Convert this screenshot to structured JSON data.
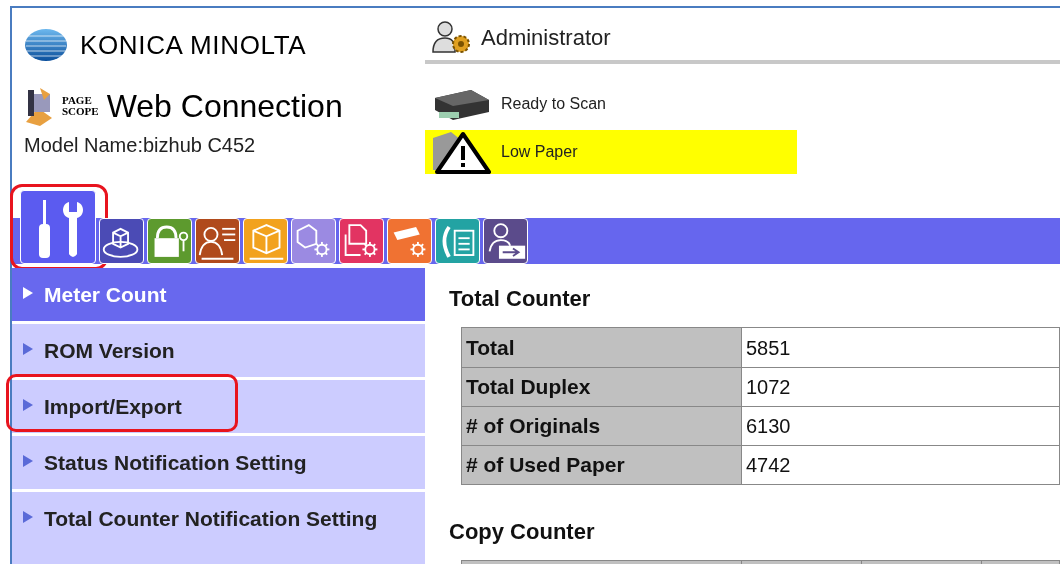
{
  "header": {
    "brand": "KONICA MINOLTA",
    "product_small_top": "PAGE",
    "product_small_bottom": "SCOPE",
    "product": "Web Connection",
    "model_name": "Model Name:bizhub C452"
  },
  "user": {
    "label": "Administrator"
  },
  "status": [
    {
      "kind": "scanner",
      "label": "Ready to Scan",
      "warning": false
    },
    {
      "kind": "warning",
      "label": "Low Paper",
      "warning": true
    }
  ],
  "tabs": [
    {
      "kind": "tools",
      "color": "#5b5bf0",
      "selected": true,
      "annotated": true
    },
    {
      "kind": "cube-disc",
      "color": "#4b4bb5",
      "selected": false,
      "annotated": false
    },
    {
      "kind": "lock",
      "color": "#5d9a2e",
      "selected": false,
      "annotated": false
    },
    {
      "kind": "person-card",
      "color": "#b04a1c",
      "selected": false,
      "annotated": false
    },
    {
      "kind": "cube-network",
      "color": "#f2a21e",
      "selected": false,
      "annotated": false
    },
    {
      "kind": "cube-gear",
      "color": "#9b8ae2",
      "selected": false,
      "annotated": false
    },
    {
      "kind": "document-gear",
      "color": "#e23462",
      "selected": false,
      "annotated": false
    },
    {
      "kind": "scanner-gear",
      "color": "#f07232",
      "selected": false,
      "annotated": false
    },
    {
      "kind": "phone-document",
      "color": "#23a3a3",
      "selected": false,
      "annotated": false
    },
    {
      "kind": "person-arrow",
      "color": "#5b4b8b",
      "selected": false,
      "annotated": false
    }
  ],
  "sidebar": {
    "items": [
      {
        "label": "Meter Count",
        "selected": true,
        "annotated": false
      },
      {
        "label": "ROM Version",
        "selected": false,
        "annotated": false
      },
      {
        "label": "Import/Export",
        "selected": false,
        "annotated": true
      },
      {
        "label": "Status Notification Setting",
        "selected": false,
        "annotated": false
      },
      {
        "label": "Total Counter Notification Setting",
        "selected": false,
        "annotated": false
      }
    ]
  },
  "content": {
    "sections": [
      {
        "title": "Total Counter",
        "rows": [
          {
            "label": "Total",
            "value": "5851"
          },
          {
            "label": "Total Duplex",
            "value": "1072"
          },
          {
            "label": "# of Originals",
            "value": "6130"
          },
          {
            "label": "# of Used Paper",
            "value": "4742"
          }
        ]
      },
      {
        "title": "Copy Counter"
      }
    ]
  }
}
